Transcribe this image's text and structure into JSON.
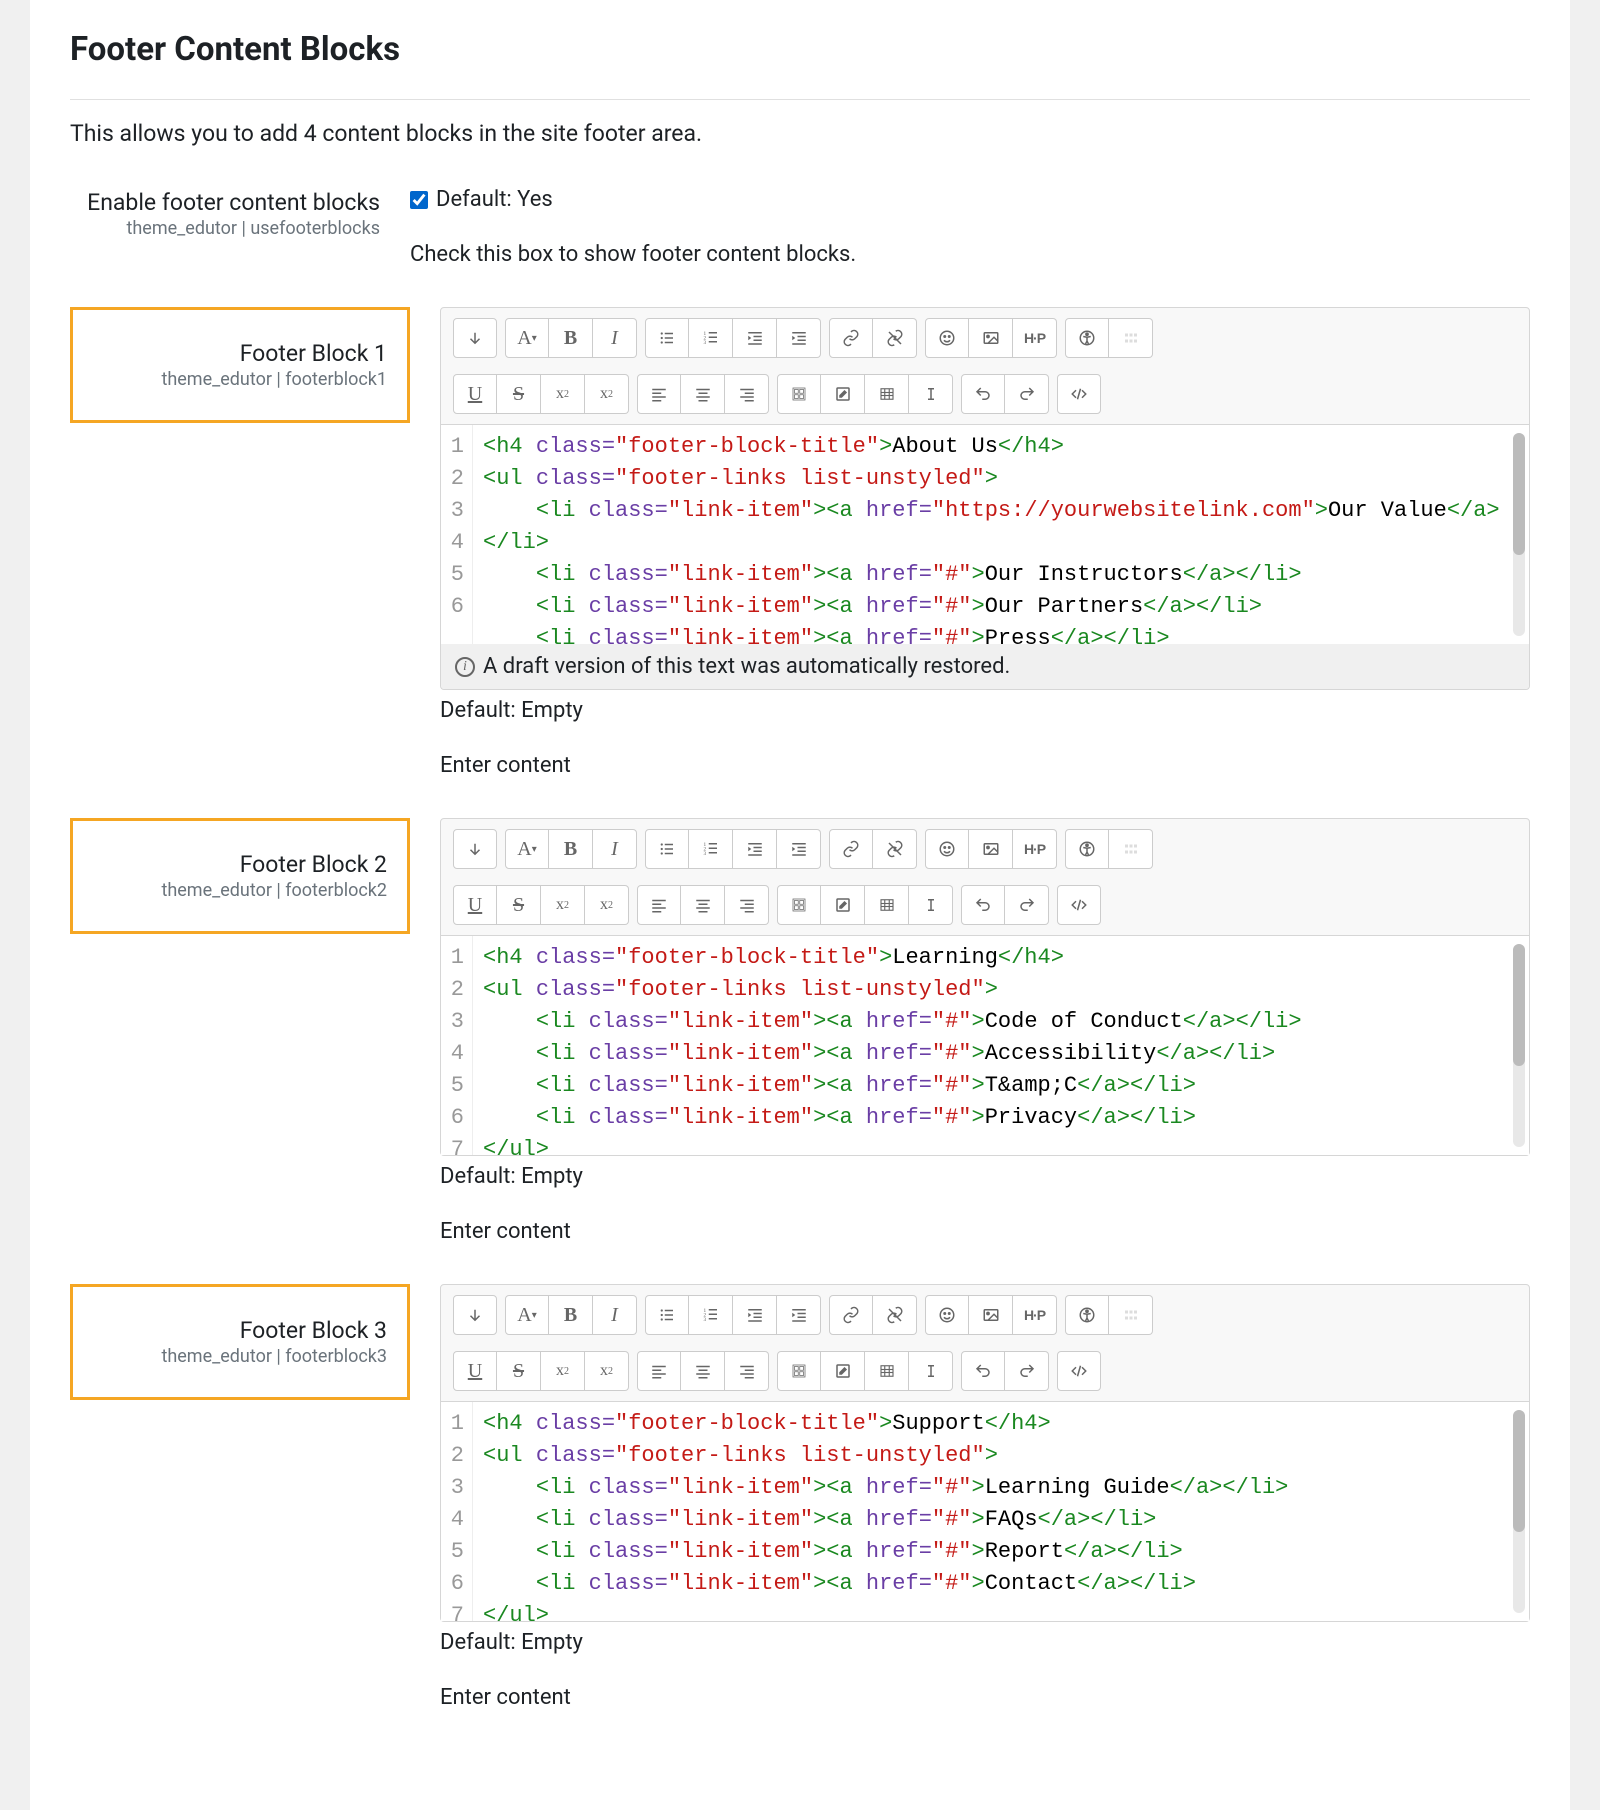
{
  "section": {
    "title": "Footer Content Blocks",
    "description": "This allows you to add 4 content blocks in the site footer area."
  },
  "enable": {
    "label": "Enable footer content blocks",
    "sub": "theme_edutor | usefooterblocks",
    "checked": true,
    "default_text": "Default: Yes",
    "help": "Check this box to show footer content blocks."
  },
  "default_empty": "Default: Empty",
  "enter_content": "Enter content",
  "restore_notice": "A draft version of this text was automatically restored.",
  "blocks": [
    {
      "label": "Footer Block 1",
      "sub": "theme_edutor | footerblock1",
      "show_restore": true,
      "code_lines": [
        [
          [
            "tag",
            "<h4"
          ],
          [
            "txt",
            " "
          ],
          [
            "attr",
            "class="
          ],
          [
            "val",
            "\"footer-block-title\""
          ],
          [
            "tag",
            ">"
          ],
          [
            "txt",
            "About Us"
          ],
          [
            "tag",
            "</h4>"
          ]
        ],
        [
          [
            "tag",
            "<ul"
          ],
          [
            "txt",
            " "
          ],
          [
            "attr",
            "class="
          ],
          [
            "val",
            "\"footer-links list-unstyled\""
          ],
          [
            "tag",
            ">"
          ]
        ],
        [
          [
            "txt",
            "    "
          ],
          [
            "tag",
            "<li"
          ],
          [
            "txt",
            " "
          ],
          [
            "attr",
            "class="
          ],
          [
            "val",
            "\"link-item\""
          ],
          [
            "tag",
            ">"
          ],
          [
            "tag",
            "<a"
          ],
          [
            "txt",
            " "
          ],
          [
            "attr",
            "href="
          ],
          [
            "val",
            "\"https://yourwebsitelink.com\""
          ],
          [
            "tag",
            ">"
          ],
          [
            "txt",
            "Our Value"
          ],
          [
            "tag",
            "</a>"
          ],
          [
            "tag",
            "</li>"
          ]
        ],
        [
          [
            "txt",
            "    "
          ],
          [
            "tag",
            "<li"
          ],
          [
            "txt",
            " "
          ],
          [
            "attr",
            "class="
          ],
          [
            "val",
            "\"link-item\""
          ],
          [
            "tag",
            ">"
          ],
          [
            "tag",
            "<a"
          ],
          [
            "txt",
            " "
          ],
          [
            "attr",
            "href="
          ],
          [
            "val",
            "\"#\""
          ],
          [
            "tag",
            ">"
          ],
          [
            "txt",
            "Our Instructors"
          ],
          [
            "tag",
            "</a>"
          ],
          [
            "tag",
            "</li>"
          ]
        ],
        [
          [
            "txt",
            "    "
          ],
          [
            "tag",
            "<li"
          ],
          [
            "txt",
            " "
          ],
          [
            "attr",
            "class="
          ],
          [
            "val",
            "\"link-item\""
          ],
          [
            "tag",
            ">"
          ],
          [
            "tag",
            "<a"
          ],
          [
            "txt",
            " "
          ],
          [
            "attr",
            "href="
          ],
          [
            "val",
            "\"#\""
          ],
          [
            "tag",
            ">"
          ],
          [
            "txt",
            "Our Partners"
          ],
          [
            "tag",
            "</a>"
          ],
          [
            "tag",
            "</li>"
          ]
        ],
        [
          [
            "txt",
            "    "
          ],
          [
            "tag",
            "<li"
          ],
          [
            "txt",
            " "
          ],
          [
            "attr",
            "class="
          ],
          [
            "val",
            "\"link-item\""
          ],
          [
            "tag",
            ">"
          ],
          [
            "tag",
            "<a"
          ],
          [
            "txt",
            " "
          ],
          [
            "attr",
            "href="
          ],
          [
            "val",
            "\"#\""
          ],
          [
            "tag",
            ">"
          ],
          [
            "txt",
            "Press"
          ],
          [
            "tag",
            "</a>"
          ],
          [
            "tag",
            "</li>"
          ]
        ]
      ]
    },
    {
      "label": "Footer Block 2",
      "sub": "theme_edutor | footerblock2",
      "show_restore": false,
      "code_lines": [
        [
          [
            "tag",
            "<h4"
          ],
          [
            "txt",
            " "
          ],
          [
            "attr",
            "class="
          ],
          [
            "val",
            "\"footer-block-title\""
          ],
          [
            "tag",
            ">"
          ],
          [
            "txt",
            "Learning"
          ],
          [
            "tag",
            "</h4>"
          ]
        ],
        [
          [
            "tag",
            "<ul"
          ],
          [
            "txt",
            " "
          ],
          [
            "attr",
            "class="
          ],
          [
            "val",
            "\"footer-links list-unstyled\""
          ],
          [
            "tag",
            ">"
          ]
        ],
        [
          [
            "txt",
            "    "
          ],
          [
            "tag",
            "<li"
          ],
          [
            "txt",
            " "
          ],
          [
            "attr",
            "class="
          ],
          [
            "val",
            "\"link-item\""
          ],
          [
            "tag",
            ">"
          ],
          [
            "tag",
            "<a"
          ],
          [
            "txt",
            " "
          ],
          [
            "attr",
            "href="
          ],
          [
            "val",
            "\"#\""
          ],
          [
            "tag",
            ">"
          ],
          [
            "txt",
            "Code of Conduct"
          ],
          [
            "tag",
            "</a>"
          ],
          [
            "tag",
            "</li>"
          ]
        ],
        [
          [
            "txt",
            "    "
          ],
          [
            "tag",
            "<li"
          ],
          [
            "txt",
            " "
          ],
          [
            "attr",
            "class="
          ],
          [
            "val",
            "\"link-item\""
          ],
          [
            "tag",
            ">"
          ],
          [
            "tag",
            "<a"
          ],
          [
            "txt",
            " "
          ],
          [
            "attr",
            "href="
          ],
          [
            "val",
            "\"#\""
          ],
          [
            "tag",
            ">"
          ],
          [
            "txt",
            "Accessibility"
          ],
          [
            "tag",
            "</a>"
          ],
          [
            "tag",
            "</li>"
          ]
        ],
        [
          [
            "txt",
            "    "
          ],
          [
            "tag",
            "<li"
          ],
          [
            "txt",
            " "
          ],
          [
            "attr",
            "class="
          ],
          [
            "val",
            "\"link-item\""
          ],
          [
            "tag",
            ">"
          ],
          [
            "tag",
            "<a"
          ],
          [
            "txt",
            " "
          ],
          [
            "attr",
            "href="
          ],
          [
            "val",
            "\"#\""
          ],
          [
            "tag",
            ">"
          ],
          [
            "txt",
            "T&amp;C"
          ],
          [
            "tag",
            "</a>"
          ],
          [
            "tag",
            "</li>"
          ]
        ],
        [
          [
            "txt",
            "    "
          ],
          [
            "tag",
            "<li"
          ],
          [
            "txt",
            " "
          ],
          [
            "attr",
            "class="
          ],
          [
            "val",
            "\"link-item\""
          ],
          [
            "tag",
            ">"
          ],
          [
            "tag",
            "<a"
          ],
          [
            "txt",
            " "
          ],
          [
            "attr",
            "href="
          ],
          [
            "val",
            "\"#\""
          ],
          [
            "tag",
            ">"
          ],
          [
            "txt",
            "Privacy"
          ],
          [
            "tag",
            "</a>"
          ],
          [
            "tag",
            "</li>"
          ]
        ],
        [
          [
            "tag",
            "</ul>"
          ]
        ]
      ]
    },
    {
      "label": "Footer Block 3",
      "sub": "theme_edutor | footerblock3",
      "show_restore": false,
      "code_lines": [
        [
          [
            "tag",
            "<h4"
          ],
          [
            "txt",
            " "
          ],
          [
            "attr",
            "class="
          ],
          [
            "val",
            "\"footer-block-title\""
          ],
          [
            "tag",
            ">"
          ],
          [
            "txt",
            "Support"
          ],
          [
            "tag",
            "</h4>"
          ]
        ],
        [
          [
            "tag",
            "<ul"
          ],
          [
            "txt",
            " "
          ],
          [
            "attr",
            "class="
          ],
          [
            "val",
            "\"footer-links list-unstyled\""
          ],
          [
            "tag",
            ">"
          ]
        ],
        [
          [
            "txt",
            "    "
          ],
          [
            "tag",
            "<li"
          ],
          [
            "txt",
            " "
          ],
          [
            "attr",
            "class="
          ],
          [
            "val",
            "\"link-item\""
          ],
          [
            "tag",
            ">"
          ],
          [
            "tag",
            "<a"
          ],
          [
            "txt",
            " "
          ],
          [
            "attr",
            "href="
          ],
          [
            "val",
            "\"#\""
          ],
          [
            "tag",
            ">"
          ],
          [
            "txt",
            "Learning Guide"
          ],
          [
            "tag",
            "</a>"
          ],
          [
            "tag",
            "</li>"
          ]
        ],
        [
          [
            "txt",
            "    "
          ],
          [
            "tag",
            "<li"
          ],
          [
            "txt",
            " "
          ],
          [
            "attr",
            "class="
          ],
          [
            "val",
            "\"link-item\""
          ],
          [
            "tag",
            ">"
          ],
          [
            "tag",
            "<a"
          ],
          [
            "txt",
            " "
          ],
          [
            "attr",
            "href="
          ],
          [
            "val",
            "\"#\""
          ],
          [
            "tag",
            ">"
          ],
          [
            "txt",
            "FAQs"
          ],
          [
            "tag",
            "</a>"
          ],
          [
            "tag",
            "</li>"
          ]
        ],
        [
          [
            "txt",
            "    "
          ],
          [
            "tag",
            "<li"
          ],
          [
            "txt",
            " "
          ],
          [
            "attr",
            "class="
          ],
          [
            "val",
            "\"link-item\""
          ],
          [
            "tag",
            ">"
          ],
          [
            "tag",
            "<a"
          ],
          [
            "txt",
            " "
          ],
          [
            "attr",
            "href="
          ],
          [
            "val",
            "\"#\""
          ],
          [
            "tag",
            ">"
          ],
          [
            "txt",
            "Report"
          ],
          [
            "tag",
            "</a>"
          ],
          [
            "tag",
            "</li>"
          ]
        ],
        [
          [
            "txt",
            "    "
          ],
          [
            "tag",
            "<li"
          ],
          [
            "txt",
            " "
          ],
          [
            "attr",
            "class="
          ],
          [
            "val",
            "\"link-item\""
          ],
          [
            "tag",
            ">"
          ],
          [
            "tag",
            "<a"
          ],
          [
            "txt",
            " "
          ],
          [
            "attr",
            "href="
          ],
          [
            "val",
            "\"#\""
          ],
          [
            "tag",
            ">"
          ],
          [
            "txt",
            "Contact"
          ],
          [
            "tag",
            "</a>"
          ],
          [
            "tag",
            "</li>"
          ]
        ],
        [
          [
            "tag",
            "</ul>"
          ]
        ]
      ]
    }
  ],
  "toolbar": {
    "row1": [
      "toggle",
      "font",
      "bold",
      "italic",
      "ul",
      "ol",
      "outdent",
      "indent",
      "link",
      "unlink",
      "emoji",
      "image",
      "h5p",
      "accessibility",
      "grid"
    ],
    "row2": [
      "underline",
      "strike",
      "sub",
      "sup",
      "align-left",
      "align-center",
      "align-right",
      "equation",
      "edit",
      "table",
      "clear",
      "undo",
      "redo",
      "code"
    ]
  }
}
